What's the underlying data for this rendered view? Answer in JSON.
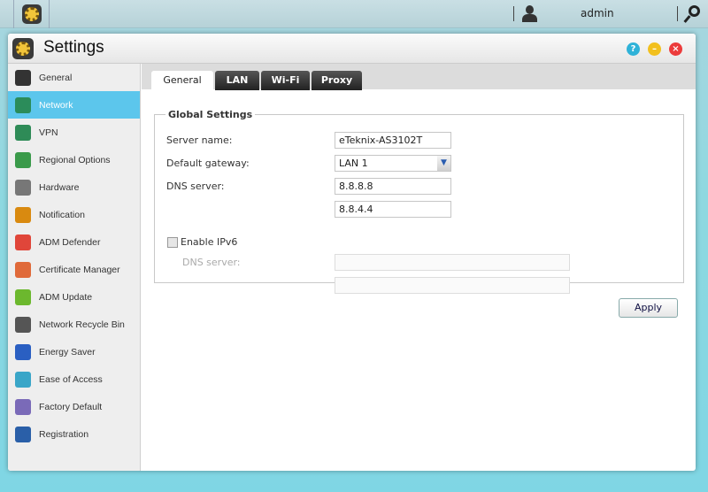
{
  "taskbar": {
    "user": "admin"
  },
  "window": {
    "title": "Settings"
  },
  "sidebar": {
    "items": [
      {
        "label": "General",
        "color": "#333333"
      },
      {
        "label": "Network",
        "color": "#2b8c5a"
      },
      {
        "label": "VPN",
        "color": "#2e8b57"
      },
      {
        "label": "Regional Options",
        "color": "#3a9a4a"
      },
      {
        "label": "Hardware",
        "color": "#777777"
      },
      {
        "label": "Notification",
        "color": "#d98a10"
      },
      {
        "label": "ADM Defender",
        "color": "#e0463a"
      },
      {
        "label": "Certificate Manager",
        "color": "#e06a3a"
      },
      {
        "label": "ADM Update",
        "color": "#6cb82e"
      },
      {
        "label": "Network Recycle Bin",
        "color": "#555555"
      },
      {
        "label": "Energy Saver",
        "color": "#2a5fc2"
      },
      {
        "label": "Ease of Access",
        "color": "#3aa6c8"
      },
      {
        "label": "Factory Default",
        "color": "#7a6ab8"
      },
      {
        "label": "Registration",
        "color": "#2a5fa8"
      }
    ],
    "selected": "Network"
  },
  "tabs": [
    "General",
    "LAN",
    "Wi-Fi",
    "Proxy"
  ],
  "form": {
    "legend": "Global Settings",
    "server_name_label": "Server name:",
    "server_name": "eTeknix-AS3102T",
    "gateway_label": "Default gateway:",
    "gateway": "LAN 1",
    "dns_label": "DNS server:",
    "dns1": "8.8.8.8",
    "dns2": "8.8.4.4",
    "ipv6_label": "Enable IPv6",
    "ipv6_checked": false,
    "ipv6_dns_label": "DNS server:",
    "ipv6_dns1": "",
    "ipv6_dns2": ""
  },
  "apply_label": "Apply"
}
